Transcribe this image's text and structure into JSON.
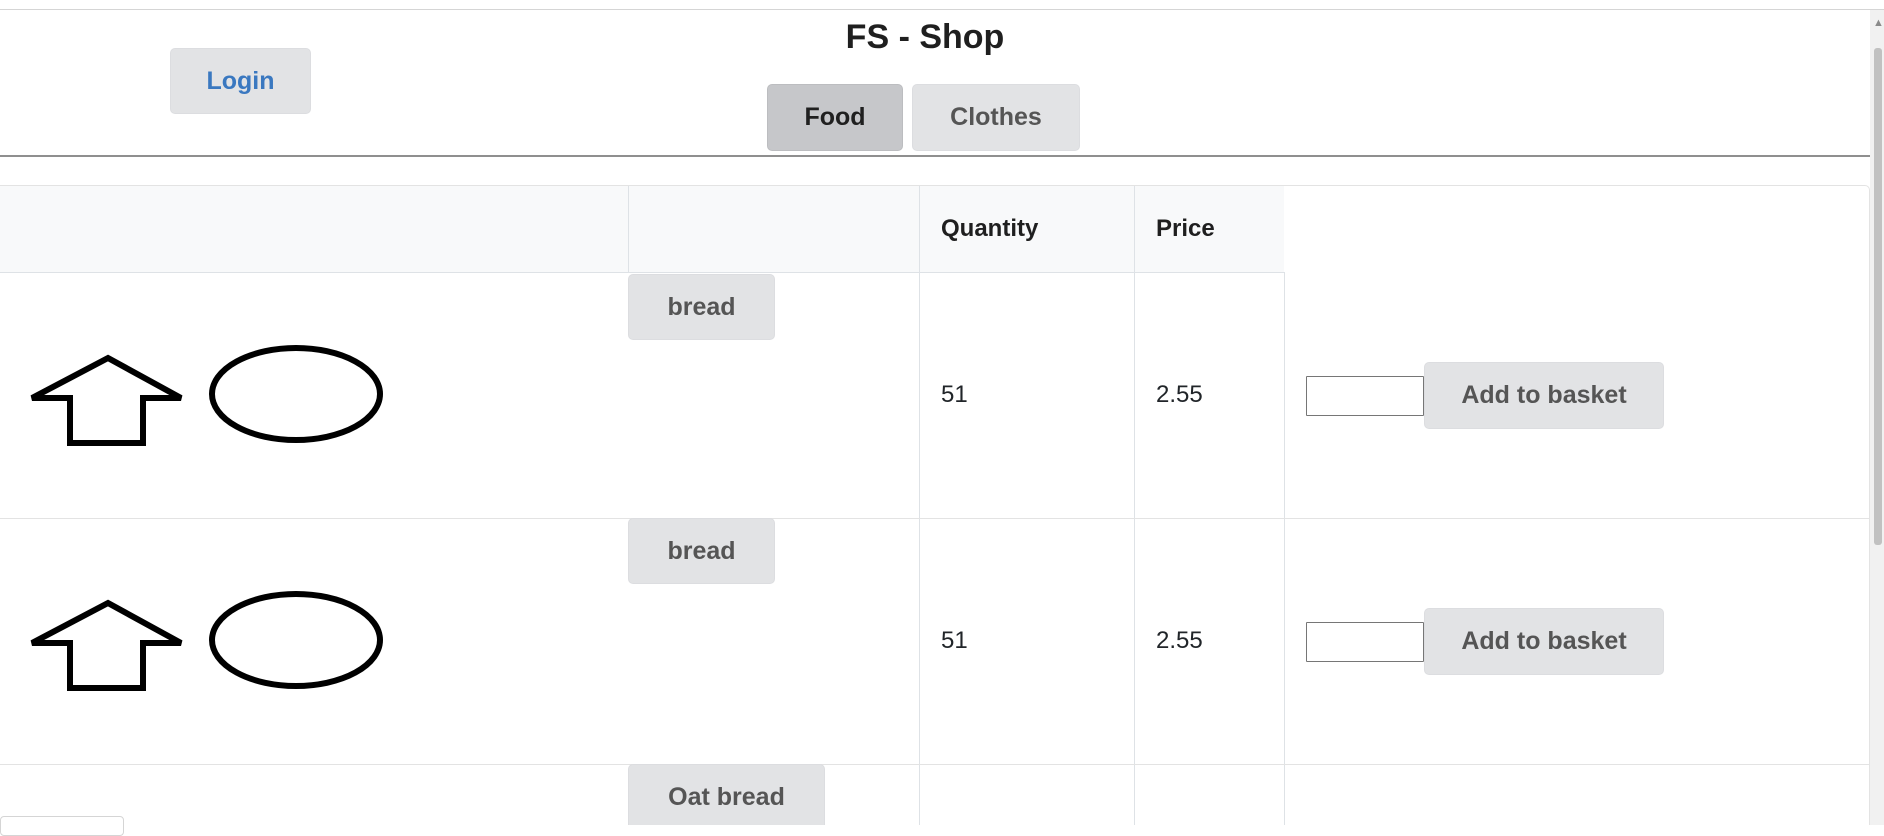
{
  "header": {
    "login_label": "Login",
    "title": "FS - Shop",
    "tabs": [
      {
        "label": "Food",
        "active": true
      },
      {
        "label": "Clothes",
        "active": false
      }
    ]
  },
  "table": {
    "columns": [
      "",
      "",
      "Quantity",
      "Price",
      ""
    ],
    "rows": [
      {
        "name": "bread",
        "quantity": "51",
        "price": "2.55",
        "action_label": "Add to basket",
        "input_value": ""
      },
      {
        "name": "bread",
        "quantity": "51",
        "price": "2.55",
        "action_label": "Add to basket",
        "input_value": ""
      },
      {
        "name": "Oat bread",
        "quantity": "",
        "price": "",
        "action_label": "",
        "input_value": ""
      }
    ]
  },
  "colors": {
    "button_bg": "#e2e3e5",
    "active_tab_bg": "#c6c7ca",
    "login_text": "#3a78c0",
    "header_rule": "#8f8f8f"
  },
  "icons": [
    "up-arrow-icon",
    "oval-icon"
  ]
}
